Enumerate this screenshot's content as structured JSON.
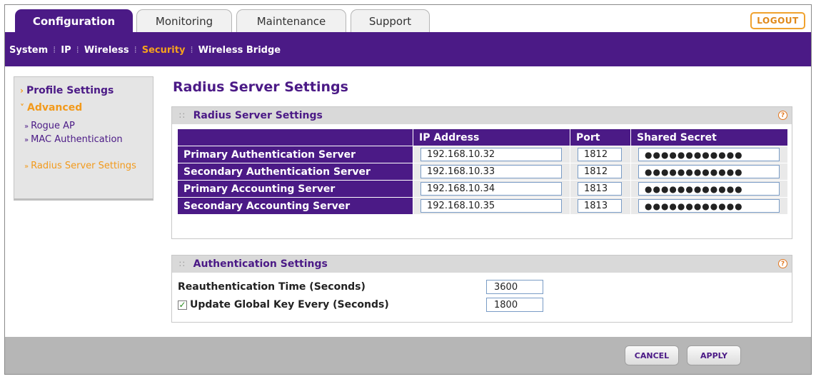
{
  "tabs": [
    {
      "label": "Configuration",
      "active": true
    },
    {
      "label": "Monitoring",
      "active": false
    },
    {
      "label": "Maintenance",
      "active": false
    },
    {
      "label": "Support",
      "active": false
    }
  ],
  "logout_label": "LOGOUT",
  "subnav": [
    {
      "label": "System",
      "active": false
    },
    {
      "label": "IP",
      "active": false
    },
    {
      "label": "Wireless",
      "active": false
    },
    {
      "label": "Security",
      "active": true
    },
    {
      "label": "Wireless Bridge",
      "active": false
    }
  ],
  "sidebar": {
    "profile_settings": "Profile Settings",
    "advanced": "Advanced",
    "items": [
      {
        "label": "Rogue AP"
      },
      {
        "label": "MAC Authentication"
      },
      {
        "label": "Radius Server Settings",
        "active": true
      }
    ]
  },
  "page_title": "Radius Server Settings",
  "radius_panel": {
    "title": "Radius Server Settings",
    "columns": [
      "IP Address",
      "Port",
      "Shared Secret"
    ],
    "rows": [
      {
        "label": "Primary Authentication Server",
        "ip": "192.168.10.32",
        "port": "1812",
        "secret": "●●●●●●●●●●●●"
      },
      {
        "label": "Secondary Authentication Server",
        "ip": "192.168.10.33",
        "port": "1812",
        "secret": "●●●●●●●●●●●●"
      },
      {
        "label": "Primary Accounting Server",
        "ip": "192.168.10.34",
        "port": "1813",
        "secret": "●●●●●●●●●●●●"
      },
      {
        "label": "Secondary Accounting Server",
        "ip": "192.168.10.35",
        "port": "1813",
        "secret": "●●●●●●●●●●●●"
      }
    ]
  },
  "auth_panel": {
    "title": "Authentication Settings",
    "reauth_label": "Reauthentication Time (Seconds)",
    "reauth_value": "3600",
    "update_key_label": "Update Global Key Every (Seconds)",
    "update_key_checked": true,
    "update_key_value": "1800"
  },
  "buttons": {
    "cancel": "CANCEL",
    "apply": "APPLY"
  },
  "colors": {
    "brand_purple": "#4b1a86",
    "accent_orange": "#f29a1c"
  }
}
